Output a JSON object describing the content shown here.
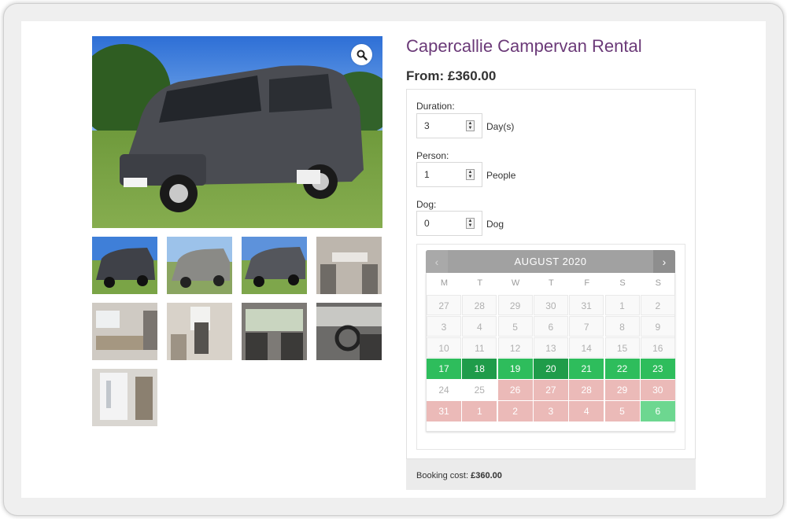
{
  "product": {
    "title": "Capercallie Campervan Rental",
    "price": "From: £360.00"
  },
  "gallery": {
    "main_image_icon": "zoom-icon",
    "thumbnail_count": 9
  },
  "form": {
    "duration": {
      "label": "Duration:",
      "value": "3",
      "unit": "Day(s)"
    },
    "person": {
      "label": "Person:",
      "value": "1",
      "unit": "People"
    },
    "dog": {
      "label": "Dog:",
      "value": "0",
      "unit": "Dog"
    }
  },
  "calendar": {
    "month_label": "AUGUST 2020",
    "prev_label": "‹",
    "next_label": "›",
    "weekdays": [
      "M",
      "T",
      "W",
      "T",
      "F",
      "S",
      "S"
    ],
    "weeks": [
      [
        {
          "d": "27",
          "s": "past"
        },
        {
          "d": "28",
          "s": "past"
        },
        {
          "d": "29",
          "s": "past"
        },
        {
          "d": "30",
          "s": "past"
        },
        {
          "d": "31",
          "s": "past"
        },
        {
          "d": "1",
          "s": "past"
        },
        {
          "d": "2",
          "s": "past"
        }
      ],
      [
        {
          "d": "3",
          "s": "past"
        },
        {
          "d": "4",
          "s": "past"
        },
        {
          "d": "5",
          "s": "past"
        },
        {
          "d": "6",
          "s": "past"
        },
        {
          "d": "7",
          "s": "past"
        },
        {
          "d": "8",
          "s": "past"
        },
        {
          "d": "9",
          "s": "past"
        }
      ],
      [
        {
          "d": "10",
          "s": "past"
        },
        {
          "d": "11",
          "s": "past"
        },
        {
          "d": "12",
          "s": "past"
        },
        {
          "d": "13",
          "s": "past"
        },
        {
          "d": "14",
          "s": "past"
        },
        {
          "d": "15",
          "s": "past"
        },
        {
          "d": "16",
          "s": "past"
        }
      ],
      [
        {
          "d": "17",
          "s": "avail"
        },
        {
          "d": "18",
          "s": "avail-dark"
        },
        {
          "d": "19",
          "s": "avail"
        },
        {
          "d": "20",
          "s": "avail-dark"
        },
        {
          "d": "21",
          "s": "avail"
        },
        {
          "d": "22",
          "s": "avail"
        },
        {
          "d": "23",
          "s": "avail"
        }
      ],
      [
        {
          "d": "24",
          "s": "blank"
        },
        {
          "d": "25",
          "s": "blank"
        },
        {
          "d": "26",
          "s": "unavail"
        },
        {
          "d": "27",
          "s": "unavail"
        },
        {
          "d": "28",
          "s": "unavail"
        },
        {
          "d": "29",
          "s": "unavail"
        },
        {
          "d": "30",
          "s": "unavail"
        }
      ],
      [
        {
          "d": "31",
          "s": "unavail"
        },
        {
          "d": "1",
          "s": "unavail"
        },
        {
          "d": "2",
          "s": "unavail"
        },
        {
          "d": "3",
          "s": "unavail"
        },
        {
          "d": "4",
          "s": "unavail"
        },
        {
          "d": "5",
          "s": "unavail"
        },
        {
          "d": "6",
          "s": "light-green"
        }
      ]
    ]
  },
  "summary": {
    "label": "Booking cost:",
    "value": "£360.00"
  },
  "colors": {
    "title": "#6b3a78",
    "available": "#2ebd5c",
    "unavailable": "#ebbab8",
    "header": "#a1a1a1"
  }
}
